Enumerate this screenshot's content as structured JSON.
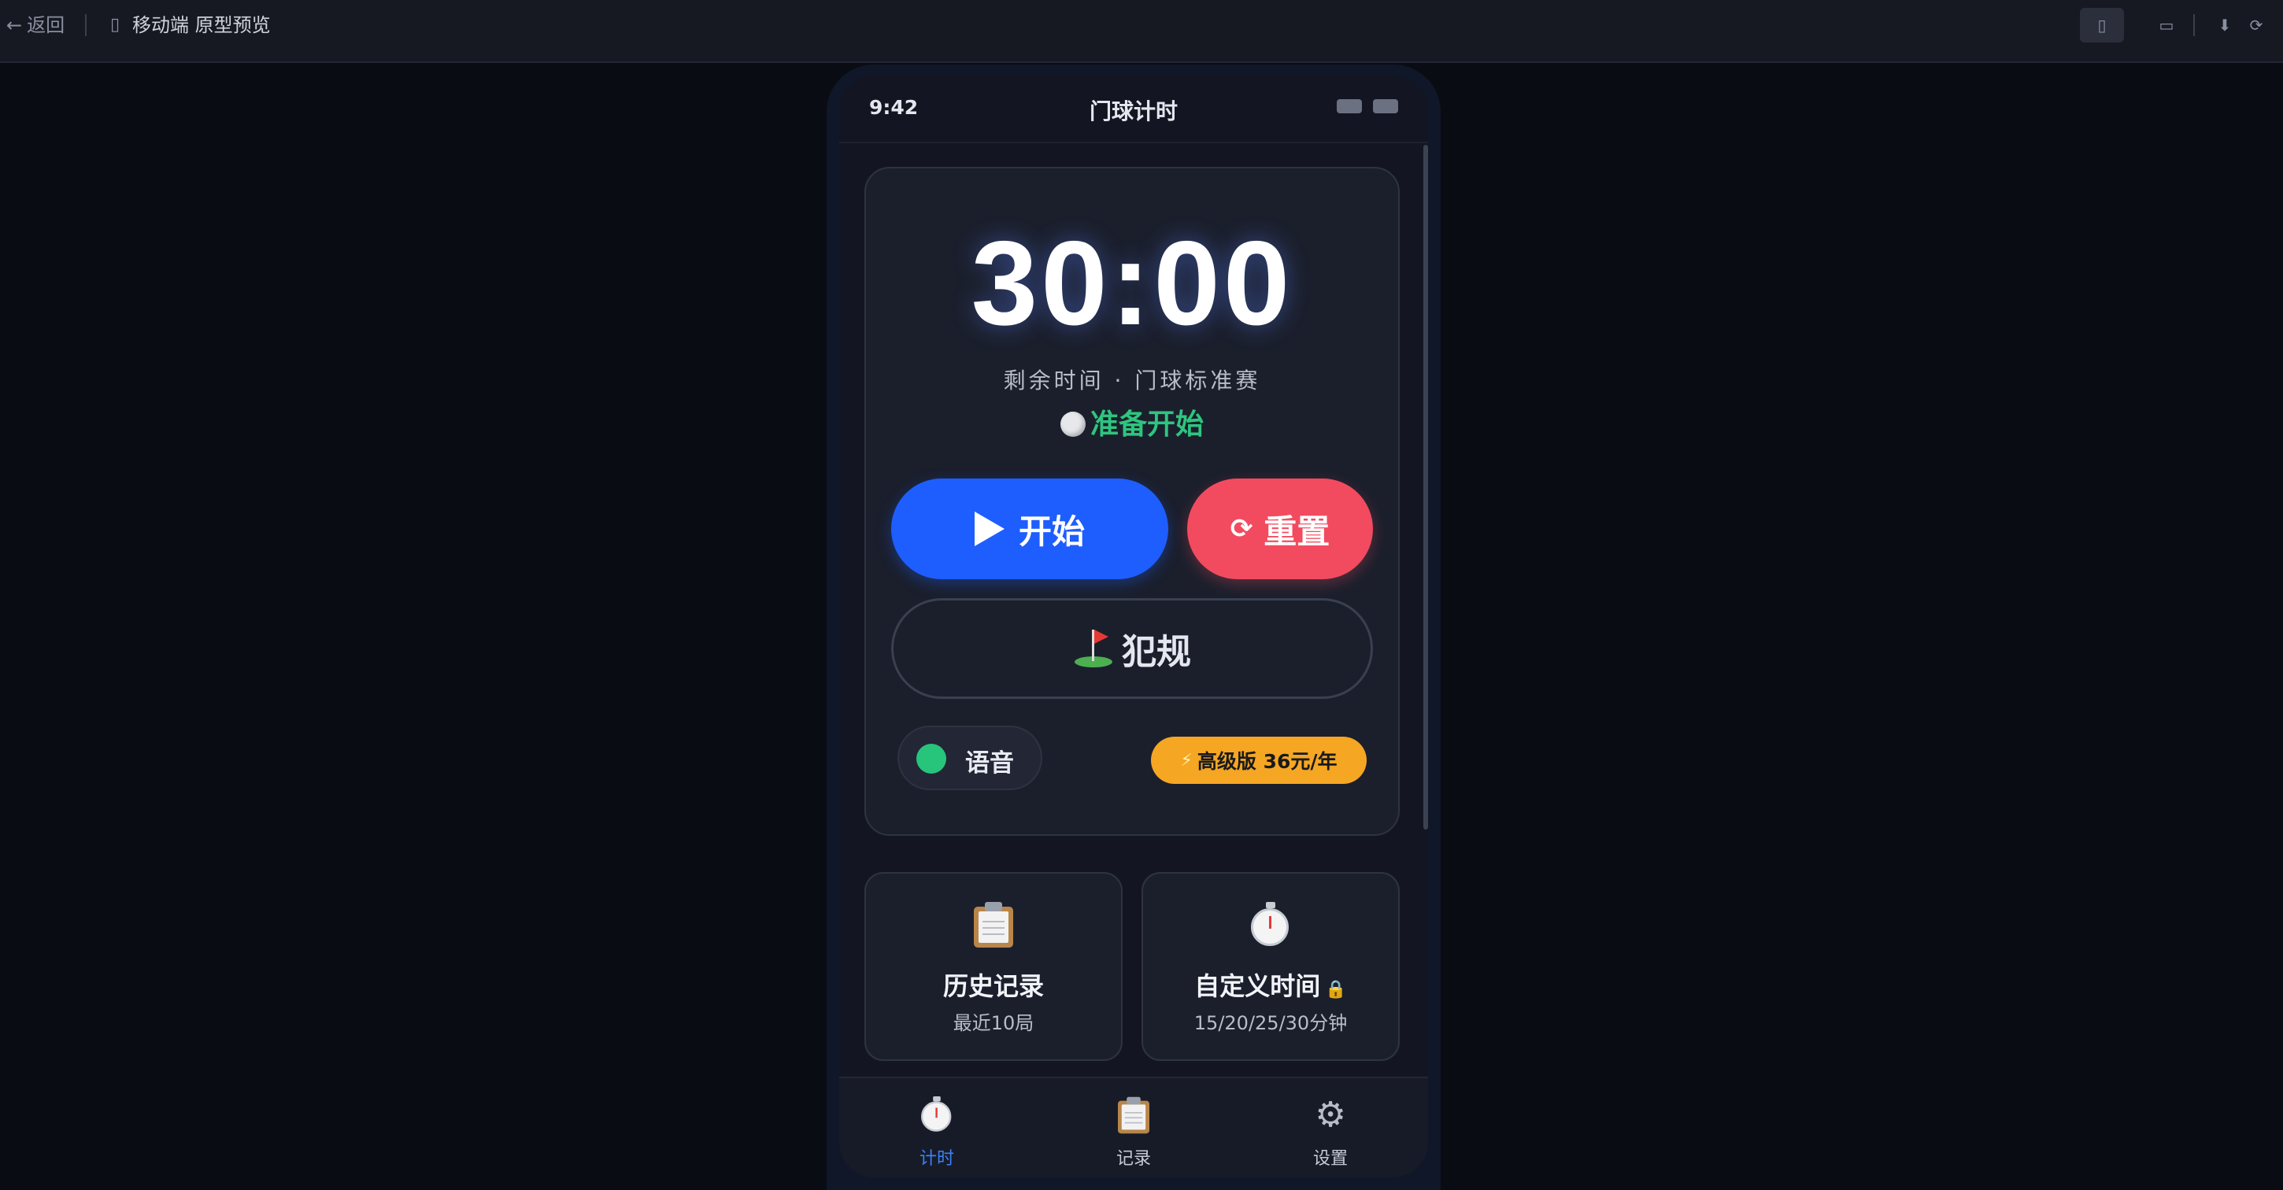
{
  "editor": {
    "back_label": "返回",
    "back_icon": "arrow-left-icon",
    "breadcrumb": "移动端 原型预览",
    "buttons": [
      "mobile-view-icon",
      "desktop-view-icon",
      "download-icon",
      "refresh-icon"
    ]
  },
  "status_bar": {
    "time": "9:42",
    "title": "门球计时"
  },
  "timer": {
    "display": "30:00",
    "subtitle": "剩余时间 · 门球标准赛",
    "status": "准备开始",
    "status_color": "#2ec57f"
  },
  "actions": {
    "start_label": "开始",
    "reset_icon": "⟳",
    "reset_label": "重置",
    "foul_label": "犯规"
  },
  "voice": {
    "label": "语音",
    "enabled": true
  },
  "premium": {
    "icon": "⚡",
    "label": "高级版 36元/年"
  },
  "cards": [
    {
      "icon": "clipboard-icon",
      "title": "历史记录",
      "subtitle": "最近10局"
    },
    {
      "icon": "stopwatch-icon",
      "title": "自定义时间",
      "lock": "🔒",
      "subtitle": "15/20/25/30分钟"
    }
  ],
  "tabs": [
    {
      "icon": "stopwatch-icon",
      "label": "计时",
      "active": true
    },
    {
      "icon": "clipboard-icon",
      "label": "记录",
      "active": false
    },
    {
      "icon": "gear-icon",
      "label": "设置",
      "active": false
    }
  ],
  "colors": {
    "primary": "#1e5eff",
    "danger": "#f24b5f",
    "premium": "#f5a623",
    "active_tab": "#3b82f6"
  }
}
